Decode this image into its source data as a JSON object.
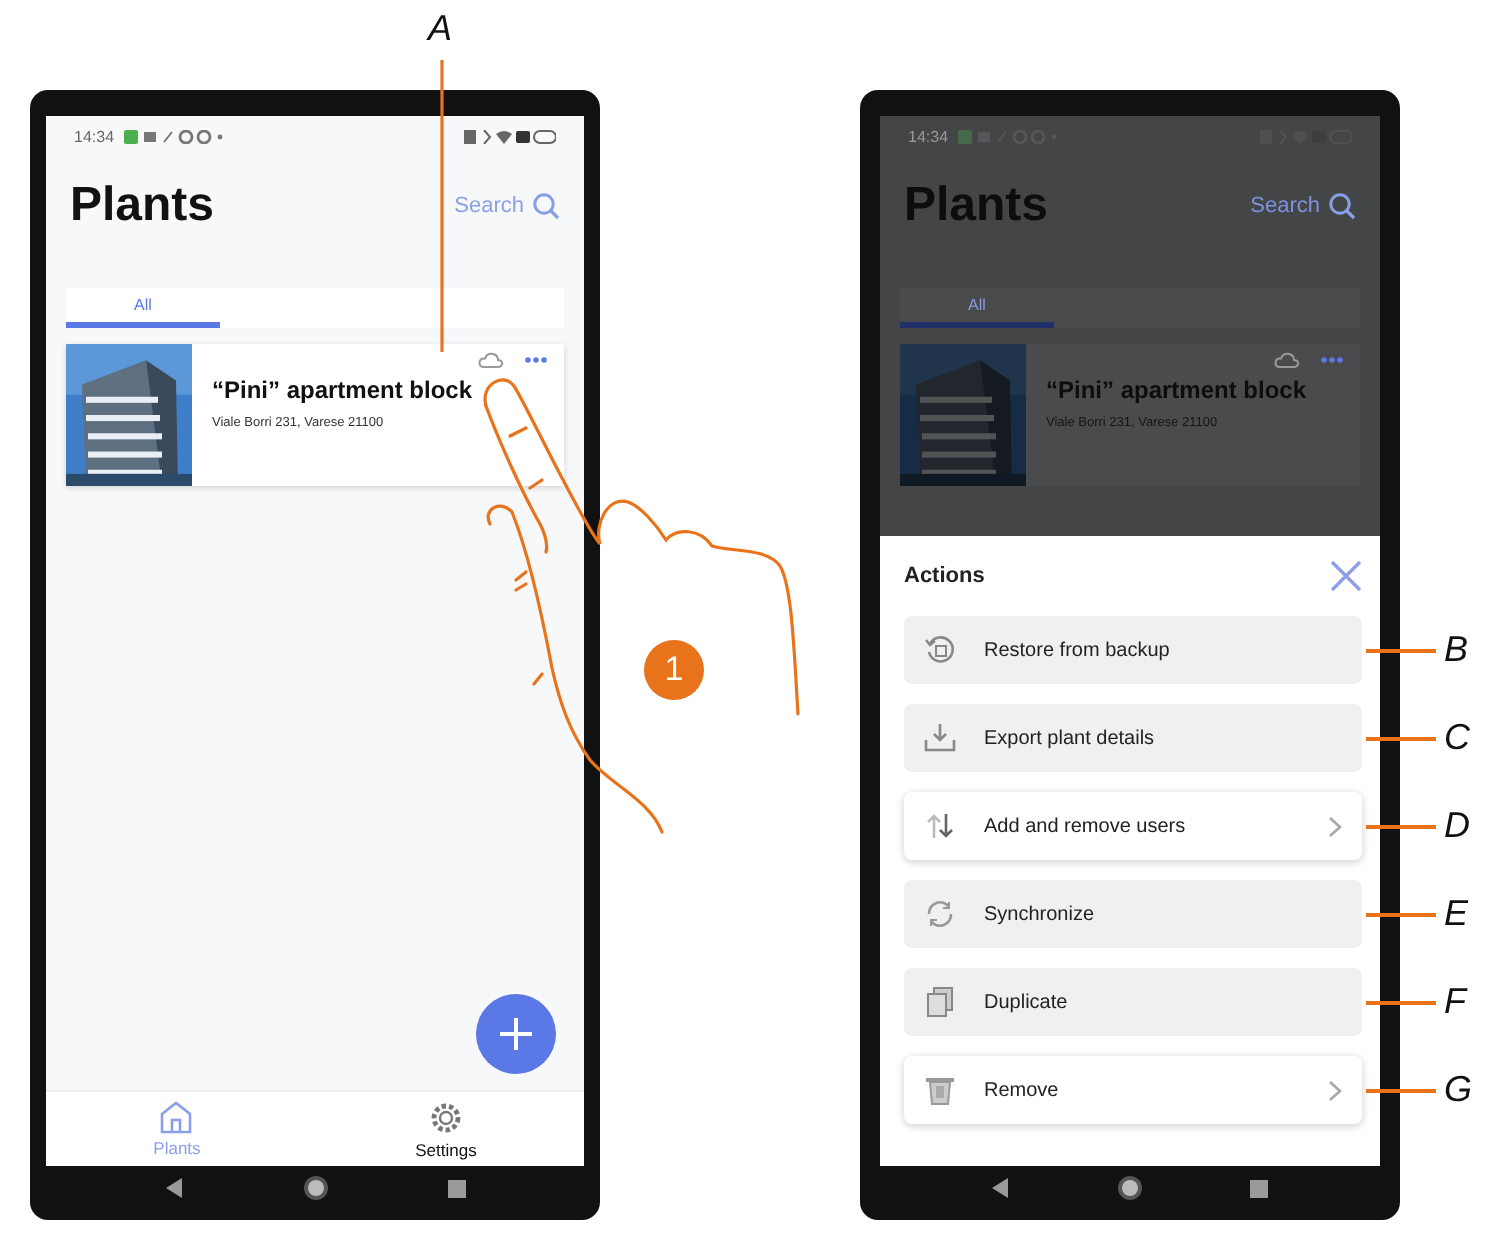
{
  "left_phone": {
    "status_time": "14:34",
    "title": "Plants",
    "search": "Search",
    "tabs": [
      {
        "label": "All",
        "selected": true
      }
    ],
    "plant": {
      "name": "“Pini” apartment block",
      "address": "Viale Borri 231, Varese 21100",
      "callout": "A"
    },
    "bottom_nav": [
      {
        "label": "Plants",
        "selected": true
      },
      {
        "label": "Settings",
        "selected": false
      }
    ]
  },
  "step_badge": "1",
  "right_phone": {
    "status_time": "14:34",
    "title": "Plants",
    "search": "Search",
    "tabs": [
      {
        "label": "All",
        "selected": true
      }
    ],
    "plant": {
      "name": "“Pini” apartment block",
      "address": "Viale Borri 231, Varese 21100"
    },
    "sheet": {
      "title": "Actions",
      "actions": [
        {
          "label": "Restore from backup",
          "kind": "action",
          "callout": "B"
        },
        {
          "label": "Export plant details",
          "kind": "action",
          "callout": "C"
        },
        {
          "label": "Add and remove users",
          "kind": "submenu",
          "callout": "D"
        },
        {
          "label": "Synchronize",
          "kind": "action",
          "callout": "E"
        },
        {
          "label": "Duplicate",
          "kind": "action",
          "callout": "F"
        },
        {
          "label": "Remove",
          "kind": "submenu",
          "callout": "G"
        }
      ]
    }
  }
}
